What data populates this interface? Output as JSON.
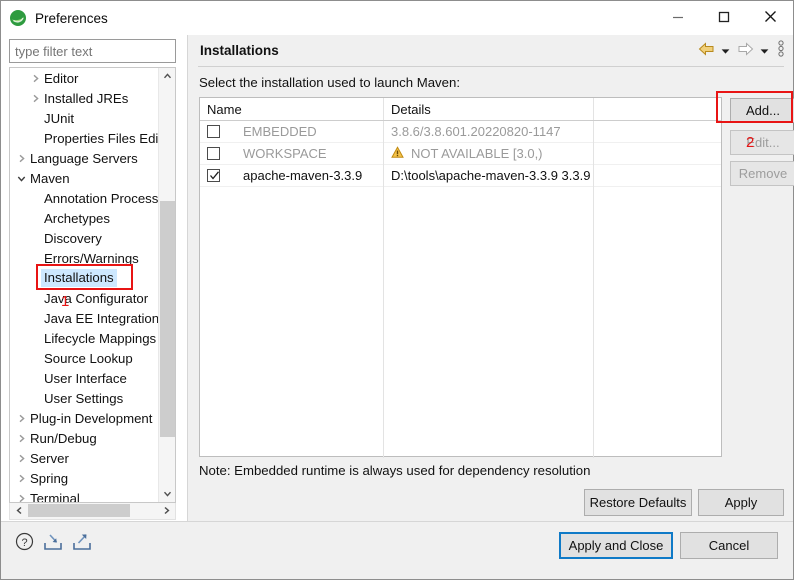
{
  "window": {
    "title": "Preferences",
    "logo_icon": "eclipse-logo-icon",
    "minimize_icon": "minimize-icon",
    "maximize_icon": "maximize-icon",
    "close_icon": "close-icon"
  },
  "colors": {
    "accent": "#0f7ac7",
    "selection": "#cde8ff",
    "annotation": "#e81414",
    "warning": "#e6a817",
    "nav_back": "#e8b64c"
  },
  "filter": {
    "placeholder": "type filter text",
    "value": ""
  },
  "tree": {
    "items": [
      {
        "label": "Editor",
        "indent": 1,
        "twisty": "collapsed",
        "selected": false
      },
      {
        "label": "Installed JREs",
        "indent": 1,
        "twisty": "collapsed",
        "selected": false
      },
      {
        "label": "JUnit",
        "indent": 1,
        "twisty": "none",
        "selected": false
      },
      {
        "label": "Properties Files Edi",
        "indent": 1,
        "twisty": "none",
        "selected": false
      },
      {
        "label": "Language Servers",
        "indent": 0,
        "twisty": "collapsed",
        "selected": false
      },
      {
        "label": "Maven",
        "indent": 0,
        "twisty": "expanded",
        "selected": false
      },
      {
        "label": "Annotation Process",
        "indent": 1,
        "twisty": "none",
        "selected": false
      },
      {
        "label": "Archetypes",
        "indent": 1,
        "twisty": "none",
        "selected": false
      },
      {
        "label": "Discovery",
        "indent": 1,
        "twisty": "none",
        "selected": false
      },
      {
        "label": "Errors/Warnings",
        "indent": 1,
        "twisty": "none",
        "selected": false
      },
      {
        "label": "Installations",
        "indent": 1,
        "twisty": "none",
        "selected": true
      },
      {
        "label": "Java Configurator",
        "indent": 1,
        "twisty": "none",
        "selected": false
      },
      {
        "label": "Java EE Integration",
        "indent": 1,
        "twisty": "none",
        "selected": false
      },
      {
        "label": "Lifecycle Mappings",
        "indent": 1,
        "twisty": "none",
        "selected": false
      },
      {
        "label": "Source Lookup",
        "indent": 1,
        "twisty": "none",
        "selected": false
      },
      {
        "label": "User Interface",
        "indent": 1,
        "twisty": "none",
        "selected": false
      },
      {
        "label": "User Settings",
        "indent": 1,
        "twisty": "none",
        "selected": false
      },
      {
        "label": "Plug-in Development",
        "indent": 0,
        "twisty": "collapsed",
        "selected": false
      },
      {
        "label": "Run/Debug",
        "indent": 0,
        "twisty": "collapsed",
        "selected": false
      },
      {
        "label": "Server",
        "indent": 0,
        "twisty": "collapsed",
        "selected": false
      },
      {
        "label": "Spring",
        "indent": 0,
        "twisty": "collapsed",
        "selected": false
      },
      {
        "label": "Terminal",
        "indent": 0,
        "twisty": "collapsed",
        "selected": false
      }
    ],
    "scroll_up_icon": "chevron-up-icon",
    "scroll_down_icon": "chevron-down-icon",
    "scroll_left_icon": "chevron-left-icon",
    "scroll_right_icon": "chevron-right-icon"
  },
  "page": {
    "title": "Installations",
    "subtitle": "Select the installation used to launch Maven:",
    "note": "Note: Embedded runtime is always used for dependency resolution",
    "nav": {
      "back_icon": "arrow-left-icon",
      "back_menu_icon": "chevron-down-icon",
      "forward_icon": "arrow-right-icon",
      "forward_menu_icon": "chevron-down-icon",
      "view_menu_icon": "vertical-dots-icon"
    }
  },
  "table": {
    "columns": [
      "Name",
      "Details",
      ""
    ],
    "rows": [
      {
        "checked": false,
        "name": "EMBEDDED",
        "details": "3.8.6/3.8.601.20220820-1147",
        "warning": false,
        "enabled": false
      },
      {
        "checked": false,
        "name": "WORKSPACE",
        "details": "NOT AVAILABLE [3.0,)",
        "warning": true,
        "warning_icon": "warning-triangle-icon",
        "enabled": false
      },
      {
        "checked": true,
        "name": "apache-maven-3.3.9",
        "details": "D:\\tools\\apache-maven-3.3.9 3.3.9",
        "warning": false,
        "enabled": true
      }
    ]
  },
  "side_buttons": {
    "add": "Add...",
    "edit": "Edit...",
    "remove": "Remove"
  },
  "page_buttons": {
    "restore_defaults": "Restore Defaults",
    "apply": "Apply"
  },
  "footer": {
    "help_icon": "help-circle-icon",
    "import_icon": "import-icon",
    "export_icon": "export-icon",
    "apply_and_close": "Apply and Close",
    "cancel": "Cancel"
  },
  "annotations": [
    {
      "number": "1",
      "target": "sidebar-item-installations"
    },
    {
      "number": "2",
      "target": "add-button"
    }
  ]
}
